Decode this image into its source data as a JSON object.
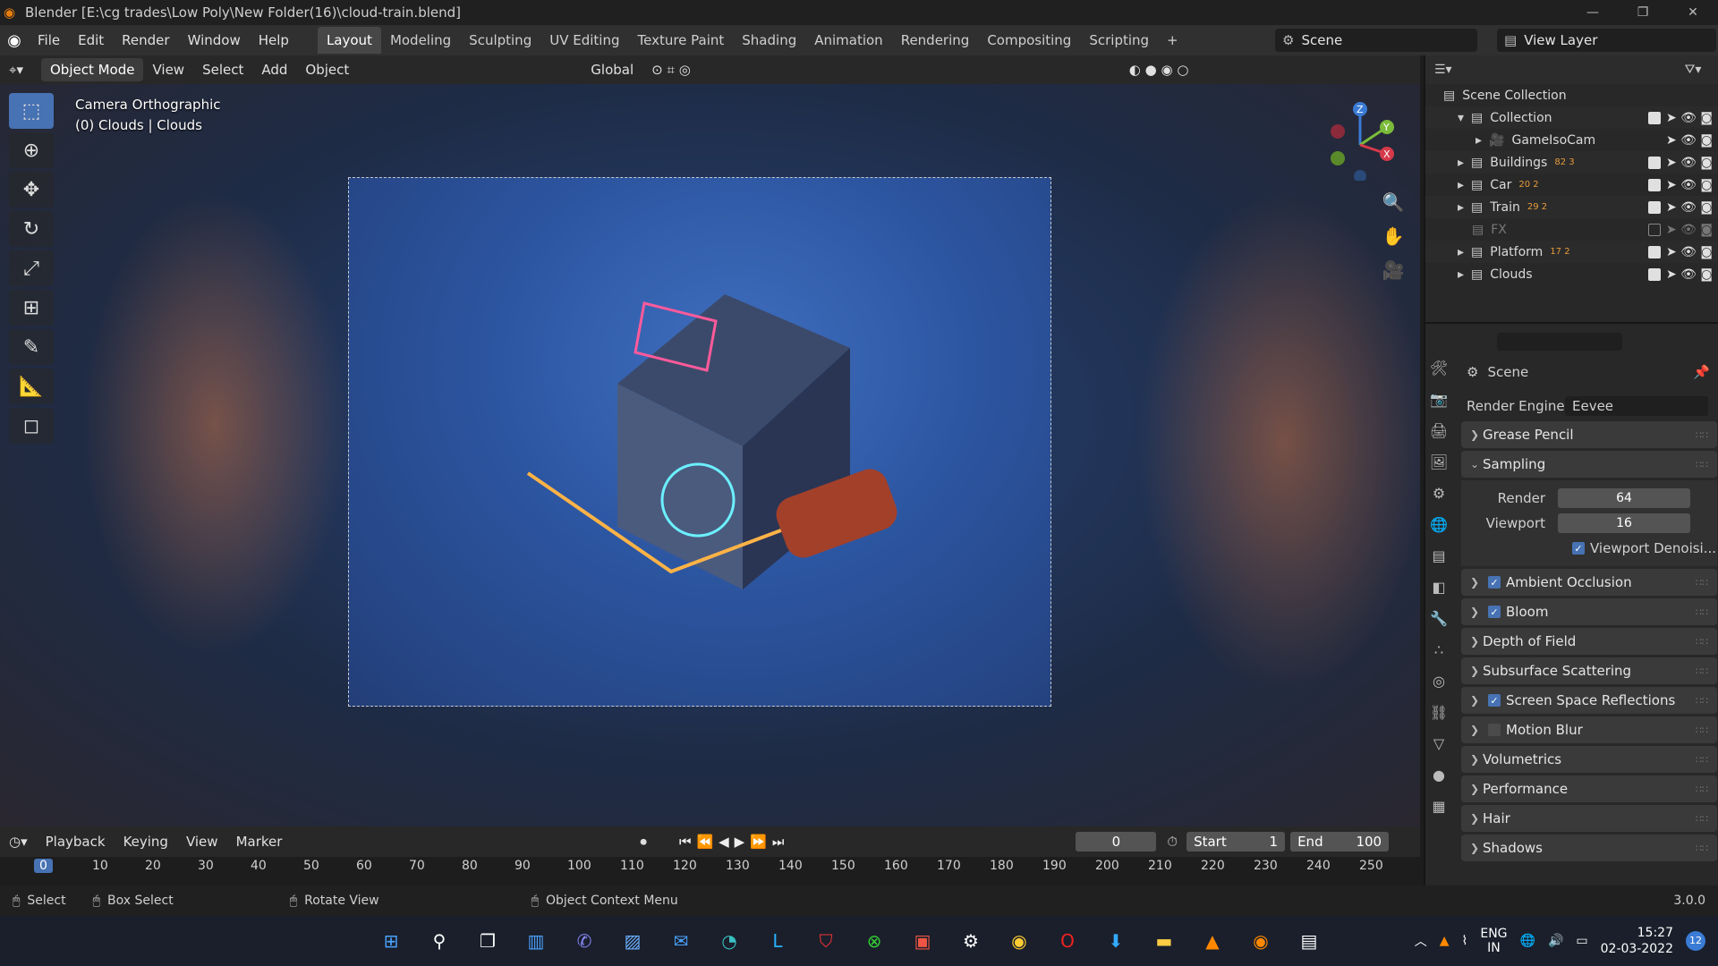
{
  "window": {
    "title": "Blender [E:\\cg trades\\Low Poly\\New Folder(16)\\cloud-train.blend]",
    "controls": [
      "—",
      "❐",
      "✕"
    ]
  },
  "menu": [
    "File",
    "Edit",
    "Render",
    "Window",
    "Help"
  ],
  "workspaces": [
    "Layout",
    "Modeling",
    "Sculpting",
    "UV Editing",
    "Texture Paint",
    "Shading",
    "Animation",
    "Rendering",
    "Compositing",
    "Scripting",
    "+"
  ],
  "scene": {
    "name": "Scene"
  },
  "view_layer": {
    "name": "View Layer"
  },
  "viewport_header": {
    "mode": "Object Mode",
    "items": [
      "View",
      "Select",
      "Add",
      "Object"
    ],
    "orientation": "Global"
  },
  "viewport": {
    "camera_label": "Camera Orthographic",
    "object_label": "(0) Clouds | Clouds"
  },
  "outliner": {
    "root": "Scene Collection",
    "rows": [
      {
        "name": "Collection",
        "badge": ""
      },
      {
        "name": "GameIsoCam",
        "badge": ""
      },
      {
        "name": "Buildings",
        "badge": "82 3"
      },
      {
        "name": "Car",
        "badge": "20 2"
      },
      {
        "name": "Train",
        "badge": "29 2"
      },
      {
        "name": "FX",
        "badge": ""
      },
      {
        "name": "Platform",
        "badge": "17 2"
      },
      {
        "name": "Clouds",
        "badge": ""
      }
    ]
  },
  "properties": {
    "context": "Scene",
    "render_engine_label": "Render Engine",
    "render_engine": "Eevee",
    "sampling": {
      "label": "Sampling",
      "render_label": "Render",
      "render": "64",
      "viewport_label": "Viewport",
      "viewport": "16",
      "denoise": "Viewport Denoisi..."
    },
    "panels": [
      {
        "label": "Grease Pencil",
        "checkbox": null
      },
      {
        "label": "Ambient Occlusion",
        "checkbox": true
      },
      {
        "label": "Bloom",
        "checkbox": true
      },
      {
        "label": "Depth of Field",
        "checkbox": null
      },
      {
        "label": "Subsurface Scattering",
        "checkbox": null
      },
      {
        "label": "Screen Space Reflections",
        "checkbox": true
      },
      {
        "label": "Motion Blur",
        "checkbox": false
      },
      {
        "label": "Volumetrics",
        "checkbox": null
      },
      {
        "label": "Performance",
        "checkbox": null
      },
      {
        "label": "Hair",
        "checkbox": null
      },
      {
        "label": "Shadows",
        "checkbox": null
      }
    ]
  },
  "timeline": {
    "menus": [
      "Playback",
      "Keying",
      "View",
      "Marker"
    ],
    "current_frame": "0",
    "start_label": "Start",
    "start": "1",
    "end_label": "End",
    "end": "100",
    "ticks": [
      "0",
      "10",
      "20",
      "30",
      "40",
      "50",
      "60",
      "70",
      "80",
      "90",
      "100",
      "110",
      "120",
      "130",
      "140",
      "150",
      "160",
      "170",
      "180",
      "190",
      "200",
      "210",
      "220",
      "230",
      "240",
      "250"
    ]
  },
  "statusbar": {
    "select": "Select",
    "box_select": "Box Select",
    "rotate": "Rotate View",
    "context_menu": "Object Context Menu",
    "version": "3.0.0"
  },
  "taskbar": {
    "lang": "ENG",
    "region": "IN",
    "time": "15:27",
    "date": "02-03-2022",
    "notif": "12"
  }
}
